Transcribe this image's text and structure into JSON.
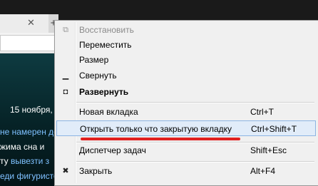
{
  "browser": {
    "tab_close_glyph": "✕",
    "new_tab_glyph": "+",
    "page_lines": [
      {
        "prefix": "",
        "text": "15 ноября,",
        "link": ""
      },
      {
        "prefix": "",
        "text": "",
        "link": "не намерен до"
      },
      {
        "prefix": "",
        "text": "жима сна и",
        "link": ""
      },
      {
        "prefix": "",
        "text": "ту ",
        "link": "вывезти з"
      },
      {
        "prefix": "",
        "text": "",
        "link": "еди фигуристок Гран-при России"
      }
    ]
  },
  "context_menu": {
    "items": [
      {
        "icon": "restore-icon",
        "glyph": "⧉",
        "label": "Восстановить",
        "shortcut": "",
        "disabled": true
      },
      {
        "icon": "",
        "glyph": "",
        "label": "Переместить",
        "shortcut": ""
      },
      {
        "icon": "",
        "glyph": "",
        "label": "Размер",
        "shortcut": ""
      },
      {
        "icon": "minimize-icon",
        "glyph": "▁",
        "label": "Свернуть",
        "shortcut": ""
      },
      {
        "icon": "maximize-icon",
        "glyph": "◘",
        "label": "Развернуть",
        "shortcut": "",
        "bold": true
      },
      {
        "icon": "",
        "glyph": "",
        "label": "Новая вкладка",
        "shortcut": "Ctrl+T"
      },
      {
        "icon": "",
        "glyph": "",
        "label": "Открыть только что закрытую вкладку",
        "shortcut": "Ctrl+Shift+T",
        "highlighted": true
      },
      {
        "icon": "",
        "glyph": "",
        "label": "Диспетчер задач",
        "shortcut": "Shift+Esc"
      },
      {
        "icon": "close-icon",
        "glyph": "✖",
        "label": "Закрыть",
        "shortcut": "Alt+F4"
      }
    ]
  },
  "colors": {
    "highlight_bg": "#e1ecf9",
    "highlight_border": "#8cb4e3",
    "annotation_underline": "#e02020"
  }
}
